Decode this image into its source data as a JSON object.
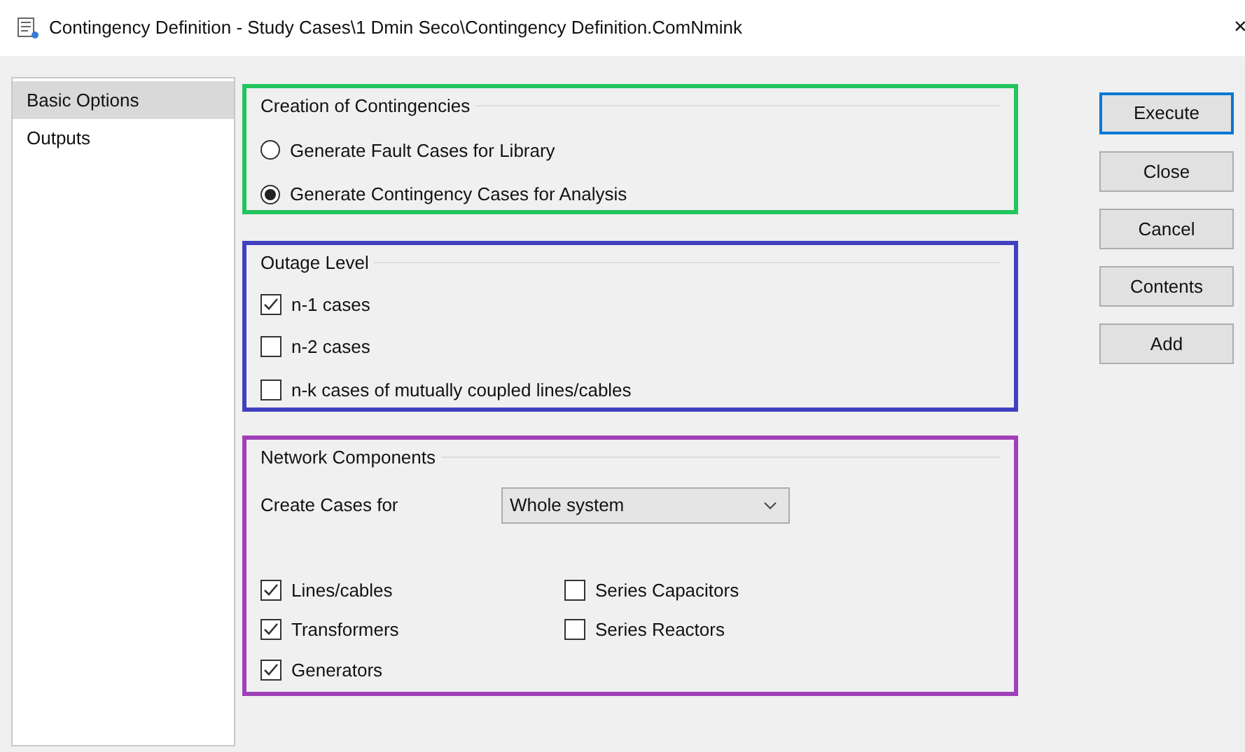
{
  "window": {
    "title": "Contingency Definition - Study Cases\\1 Dmin Seco\\Contingency Definition.ComNmink",
    "close": "×"
  },
  "sidebar": {
    "items": [
      {
        "label": "Basic Options",
        "selected": true
      },
      {
        "label": "Outputs",
        "selected": false
      }
    ]
  },
  "groups": [
    {
      "title": "Creation of Contingencies",
      "color": "#22c55e",
      "options": [
        {
          "kind": "radio",
          "label": "Generate Fault Cases for Library",
          "checked": false
        },
        {
          "kind": "radio",
          "label": "Generate Contingency Cases for Analysis",
          "checked": true
        }
      ]
    },
    {
      "title": "Outage Level",
      "color": "#4040c0",
      "options": [
        {
          "kind": "checkbox",
          "label": "n-1 cases",
          "checked": true
        },
        {
          "kind": "checkbox",
          "label": "n-2 cases",
          "checked": false
        },
        {
          "kind": "checkbox",
          "label": "n-k cases of mutually coupled lines/cables",
          "checked": false
        }
      ]
    },
    {
      "title": "Network Components",
      "color": "#a040b8",
      "dropdown": {
        "label": "Create Cases for",
        "value": "Whole system"
      },
      "options": [
        {
          "kind": "checkbox",
          "label": "Lines/cables",
          "checked": true
        },
        {
          "kind": "checkbox",
          "label": "Series Capacitors",
          "checked": false
        },
        {
          "kind": "checkbox",
          "label": "Transformers",
          "checked": true
        },
        {
          "kind": "checkbox",
          "label": "Series Reactors",
          "checked": false
        },
        {
          "kind": "checkbox",
          "label": "Generators",
          "checked": true
        }
      ]
    }
  ],
  "buttons": [
    {
      "label": "Execute",
      "default": true
    },
    {
      "label": "Close",
      "default": false
    },
    {
      "label": "Cancel",
      "default": false
    },
    {
      "label": "Contents",
      "default": false
    },
    {
      "label": "Add",
      "default": false
    }
  ]
}
